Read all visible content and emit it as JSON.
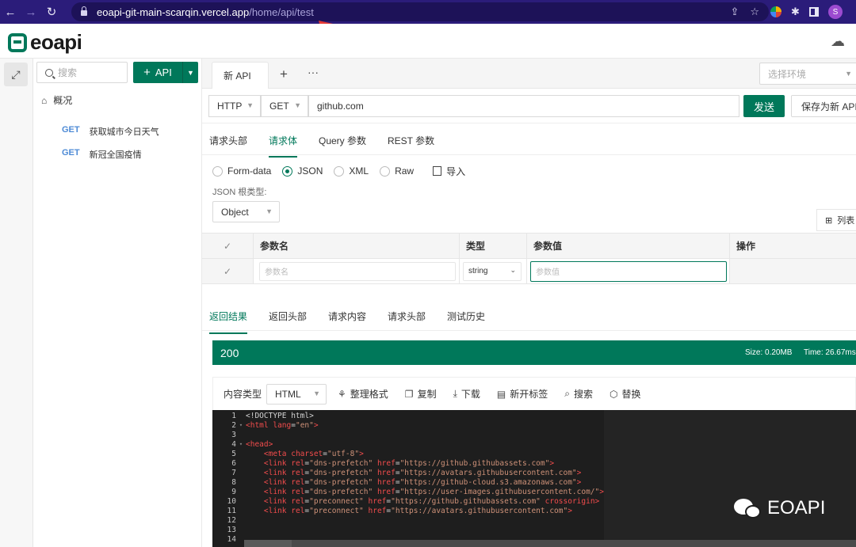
{
  "browser": {
    "url_host": "eoapi-git-main-scarqin.vercel.app",
    "url_path": "/home/api/test",
    "profile_initial": "S"
  },
  "app": {
    "logo_text": "eoapi"
  },
  "sidebar": {
    "search_placeholder": "搜索",
    "add_api_label": "API",
    "overview_label": "概况",
    "apis": [
      {
        "method": "GET",
        "name": "获取城市今日天气"
      },
      {
        "method": "GET",
        "name": "新冠全国疫情"
      }
    ]
  },
  "tabs": {
    "active_tab": "新 API",
    "add_symbol": "+",
    "more_symbol": "···",
    "env_placeholder": "选择环境"
  },
  "request": {
    "protocol": "HTTP",
    "method": "GET",
    "url": "github.com",
    "send_label": "发送",
    "save_label": "保存为新 API"
  },
  "request_tabs": [
    "请求头部",
    "请求体",
    "Query 参数",
    "REST 参数"
  ],
  "request_tab_active": 1,
  "body_types": [
    "Form-data",
    "JSON",
    "XML",
    "Raw"
  ],
  "body_type_selected": "JSON",
  "import_label": "导入",
  "json_root_label": "JSON 根类型:",
  "json_root_value": "Object",
  "list_button_label": "列表",
  "params_table": {
    "headers": [
      "参数名",
      "类型",
      "参数值",
      "操作"
    ],
    "row": {
      "name_placeholder": "参数名",
      "type": "string",
      "value_placeholder": "参数值"
    }
  },
  "response_tabs": [
    "返回结果",
    "返回头部",
    "请求内容",
    "请求头部",
    "测试历史"
  ],
  "response_tab_active": 0,
  "response": {
    "status": "200",
    "size": "Size: 0.20MB",
    "time": "Time: 26.67ms"
  },
  "response_toolbar": {
    "content_type_label": "内容类型",
    "content_type": "HTML",
    "format": "整理格式",
    "copy": "复制",
    "download": "下载",
    "new_tab": "新开标签",
    "search": "搜索",
    "replace": "替换"
  },
  "code_lines": [
    {
      "n": "1",
      "fold": "",
      "text": "<!DOCTYPE html>"
    },
    {
      "n": "2",
      "fold": "▾",
      "text": "<html lang=\"en\">"
    },
    {
      "n": "3",
      "fold": "",
      "text": ""
    },
    {
      "n": "4",
      "fold": "▾",
      "text": "<head>"
    },
    {
      "n": "5",
      "fold": "",
      "text": "    <meta charset=\"utf-8\">"
    },
    {
      "n": "6",
      "fold": "",
      "text": "    <link rel=\"dns-prefetch\" href=\"https://github.githubassets.com\">"
    },
    {
      "n": "7",
      "fold": "",
      "text": "    <link rel=\"dns-prefetch\" href=\"https://avatars.githubusercontent.com\">"
    },
    {
      "n": "8",
      "fold": "",
      "text": "    <link rel=\"dns-prefetch\" href=\"https://github-cloud.s3.amazonaws.com\">"
    },
    {
      "n": "9",
      "fold": "",
      "text": "    <link rel=\"dns-prefetch\" href=\"https://user-images.githubusercontent.com/\">"
    },
    {
      "n": "10",
      "fold": "",
      "text": "    <link rel=\"preconnect\" href=\"https://github.githubassets.com\" crossorigin>"
    },
    {
      "n": "11",
      "fold": "",
      "text": "    <link rel=\"preconnect\" href=\"https://avatars.githubusercontent.com\">"
    },
    {
      "n": "12",
      "fold": "",
      "text": ""
    },
    {
      "n": "13",
      "fold": "",
      "text": ""
    },
    {
      "n": "14",
      "fold": "",
      "text": ""
    }
  ],
  "watermark": "EOAPI",
  "colors": {
    "brand": "#00785a",
    "method_get": "#4e8bd6",
    "browser_frame": "#2b1c7a"
  }
}
